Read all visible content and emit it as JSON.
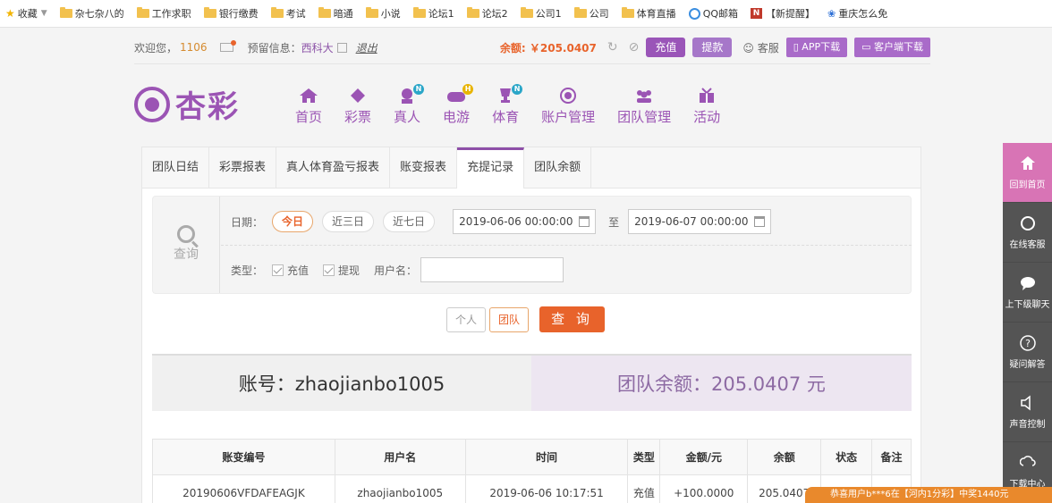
{
  "bookmarks": [
    "收藏",
    "杂七杂八的",
    "工作求职",
    "银行缴费",
    "考试",
    "暗通",
    "小说",
    "论坛1",
    "论坛2",
    "公司1",
    "公司",
    "体育直播",
    "QQ邮箱",
    "【新提醒】",
    "重庆怎么免"
  ],
  "topinfo": {
    "welcome": "欢迎您，",
    "uid": "1106",
    "reserved_label": "预留信息：",
    "reserved_value": "西科大",
    "logout": "退出",
    "balance": "余额: ￥205.0407",
    "recharge": "充值",
    "withdraw": "提款",
    "service": "客服",
    "app_download": "APP下载",
    "client_download": "客户端下载"
  },
  "logo": {
    "text": "杏彩"
  },
  "nav": [
    {
      "label": "首页",
      "badge": ""
    },
    {
      "label": "彩票",
      "badge": ""
    },
    {
      "label": "真人",
      "badge": "N"
    },
    {
      "label": "电游",
      "badge": "H"
    },
    {
      "label": "体育",
      "badge": "N"
    },
    {
      "label": "账户管理",
      "badge": ""
    },
    {
      "label": "团队管理",
      "badge": ""
    },
    {
      "label": "活动",
      "badge": ""
    }
  ],
  "tabs": [
    "团队日结",
    "彩票报表",
    "真人体育盈亏报表",
    "账变报表",
    "充提记录",
    "团队余额"
  ],
  "active_tab": "充提记录",
  "filter": {
    "query_label": "查询",
    "date_label": "日期：",
    "chips": [
      "今日",
      "近三日",
      "近七日"
    ],
    "date_from": "2019-06-06 00:00:00",
    "to_label": "至",
    "date_to": "2019-06-07 00:00:00",
    "type_label": "类型：",
    "type_recharge": "充值",
    "type_withdraw": "提现",
    "username_label": "用户名："
  },
  "actions": {
    "personal": "个人",
    "team": "团队",
    "query": "查 询"
  },
  "summary": {
    "account": "账号：zhaojianbo1005",
    "team_balance": "团队余额：205.0407 元"
  },
  "table": {
    "headers": [
      "账变编号",
      "用户名",
      "时间",
      "类型",
      "金额/元",
      "余额",
      "状态",
      "备注"
    ],
    "rows": [
      [
        "20190606VFDAFEAGJK",
        "zhaojianbo1005",
        "2019-06-06 10:17:51",
        "充值",
        "+100.0000",
        "205.0407",
        "",
        ""
      ]
    ]
  },
  "side": [
    "回到首页",
    "在线客服",
    "上下级聊天",
    "疑问解答",
    "声音控制",
    "下载中心"
  ],
  "ticker": "恭喜用户b***6在【河内1分彩】中奖1440元"
}
